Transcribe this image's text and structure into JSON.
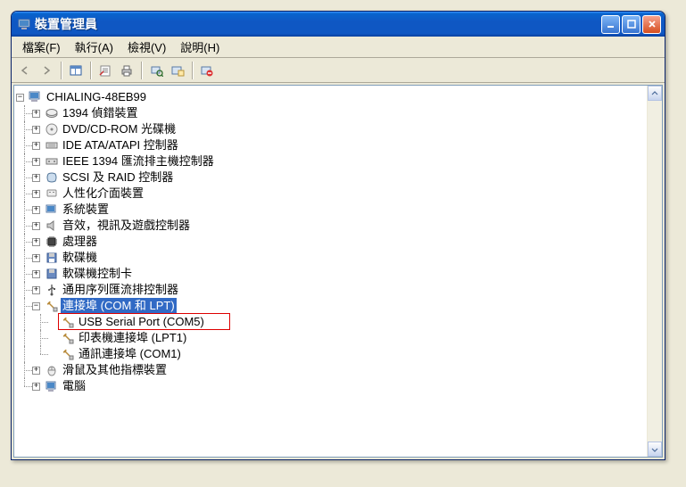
{
  "window": {
    "title": "裝置管理員"
  },
  "menu": {
    "file": "檔案(F)",
    "action": "執行(A)",
    "view": "檢視(V)",
    "help": "說明(H)"
  },
  "tree": {
    "root": "CHIALING-48EB99",
    "n1": "1394 偵錯裝置",
    "n2": "DVD/CD-ROM 光碟機",
    "n3": "IDE ATA/ATAPI 控制器",
    "n4": "IEEE 1394 匯流排主機控制器",
    "n5": "SCSI 及 RAID 控制器",
    "n6": "人性化介面裝置",
    "n7": "系統裝置",
    "n8": "音效，視訊及遊戲控制器",
    "n9": "處理器",
    "n10": "軟碟機",
    "n11": "軟碟機控制卡",
    "n12": "通用序列匯流排控制器",
    "n13": "連接埠 (COM 和 LPT)",
    "n13_1": "USB Serial Port (COM5)",
    "n13_2": "印表機連接埠 (LPT1)",
    "n13_3": "通訊連接埠 (COM1)",
    "n14": "滑鼠及其他指標裝置",
    "n15": "電腦"
  }
}
